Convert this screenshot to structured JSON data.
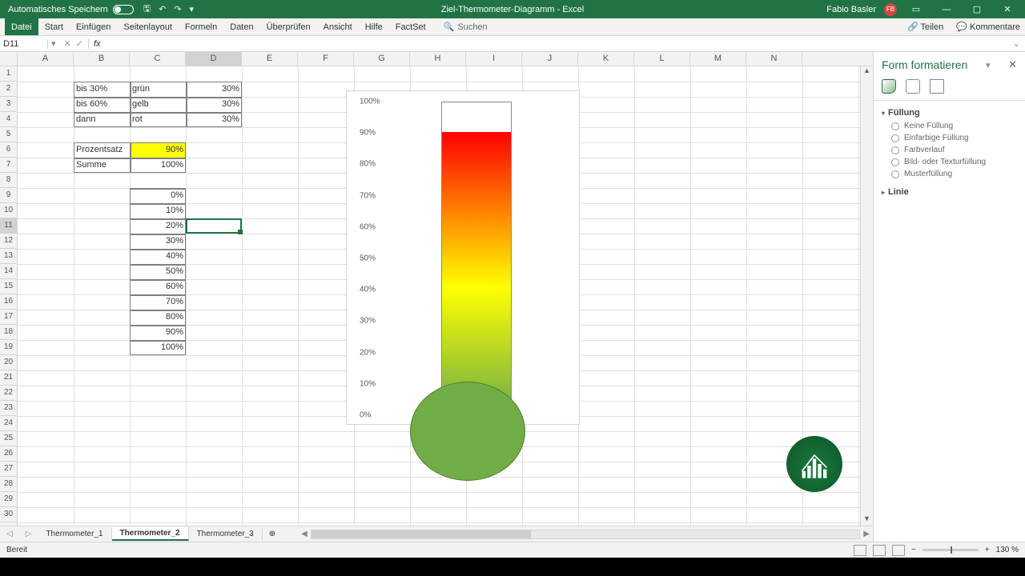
{
  "titlebar": {
    "autosave": "Automatisches Speichern",
    "title": "Ziel-Thermometer-Diagramm - Excel",
    "user": "Fabio Basler",
    "initials": "FB"
  },
  "ribbon": {
    "tabs": [
      "Datei",
      "Start",
      "Einfügen",
      "Seitenlayout",
      "Formeln",
      "Daten",
      "Überprüfen",
      "Ansicht",
      "Hilfe",
      "FactSet"
    ],
    "search": "Suchen",
    "share": "Teilen",
    "comments": "Kommentare"
  },
  "fbar": {
    "namebox": "D11",
    "fx": "fx"
  },
  "cols": [
    "A",
    "B",
    "C",
    "D",
    "E",
    "F",
    "G",
    "H",
    "I",
    "J",
    "K",
    "L",
    "M",
    "N"
  ],
  "rows": 32,
  "selected": {
    "col": "D",
    "row": 11
  },
  "table1": {
    "r2": {
      "b": "bis 30%",
      "c": "grün",
      "d": "30%"
    },
    "r3": {
      "b": "bis 60%",
      "c": "gelb",
      "d": "30%"
    },
    "r4": {
      "b": "dann",
      "c": "rot",
      "d": "30%"
    }
  },
  "table2": {
    "r6": {
      "b": "Prozentsatz",
      "c": "90%"
    },
    "r7": {
      "b": "Summe",
      "c": "100%"
    }
  },
  "pct_column": [
    "0%",
    "10%",
    "20%",
    "30%",
    "40%",
    "50%",
    "60%",
    "70%",
    "80%",
    "90%",
    "100%"
  ],
  "chart_data": {
    "type": "bar",
    "categories": [
      ""
    ],
    "values": [
      90
    ],
    "ylabel": "",
    "ylim": [
      0,
      100
    ],
    "yticks": [
      "0%",
      "10%",
      "20%",
      "30%",
      "40%",
      "50%",
      "60%",
      "70%",
      "80%",
      "90%",
      "100%"
    ],
    "fill_gradient": [
      "#70ad47",
      "#ffff00",
      "#ff0000"
    ],
    "title": ""
  },
  "panel": {
    "title": "Form formatieren",
    "sect_fill": "Füllung",
    "opts": [
      "Keine Füllung",
      "Einfarbige Füllung",
      "Farbverlauf",
      "Bild- oder Texturfüllung",
      "Musterfüllung"
    ],
    "sect_line": "Linie"
  },
  "sheets": [
    "Thermometer_1",
    "Thermometer_2",
    "Thermometer_3"
  ],
  "active_sheet": 1,
  "status": {
    "ready": "Bereit",
    "zoom": "130 %"
  }
}
